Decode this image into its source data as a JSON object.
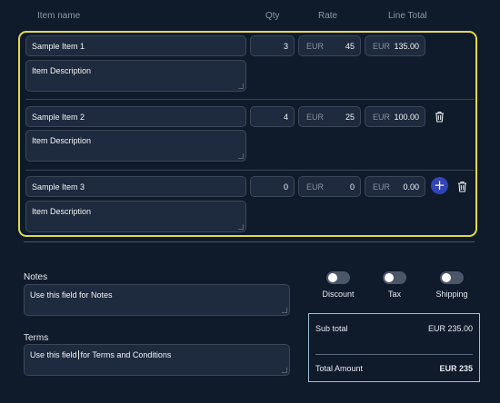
{
  "header": {
    "item_name": "Item name",
    "qty": "Qty",
    "rate": "Rate",
    "line_total": "Line Total"
  },
  "items": [
    {
      "name": "Sample Item 1",
      "description": "Item Description",
      "qty": "3",
      "rate_currency": "EUR",
      "rate": "45",
      "total_currency": "EUR",
      "total": "135.00"
    },
    {
      "name": "Sample Item 2",
      "description": "Item Description",
      "qty": "4",
      "rate_currency": "EUR",
      "rate": "25",
      "total_currency": "EUR",
      "total": "100.00"
    },
    {
      "name": "Sample Item 3",
      "description": "Item Description",
      "qty": "0",
      "rate_currency": "EUR",
      "rate": "0",
      "total_currency": "EUR",
      "total": "0.00"
    }
  ],
  "notes": {
    "label": "Notes",
    "value": "Use this field for Notes"
  },
  "terms": {
    "label": "Terms",
    "value_before_cursor": "Use this field",
    "value_after_cursor": "for Terms and Conditions"
  },
  "toggles": [
    {
      "label": "Discount",
      "on": false
    },
    {
      "label": "Tax",
      "on": false
    },
    {
      "label": "Shipping",
      "on": false
    }
  ],
  "totals": {
    "subtotal_label": "Sub total",
    "subtotal_value": "EUR 235.00",
    "total_label": "Total Amount",
    "total_value": "EUR 235"
  },
  "icons": {
    "trash": "trash-icon",
    "add": "plus-icon"
  },
  "colors": {
    "background": "#0f1a2b",
    "highlight_border": "#e3d84a",
    "add_button": "#3344b8",
    "totals_border": "#9fc2d8"
  }
}
